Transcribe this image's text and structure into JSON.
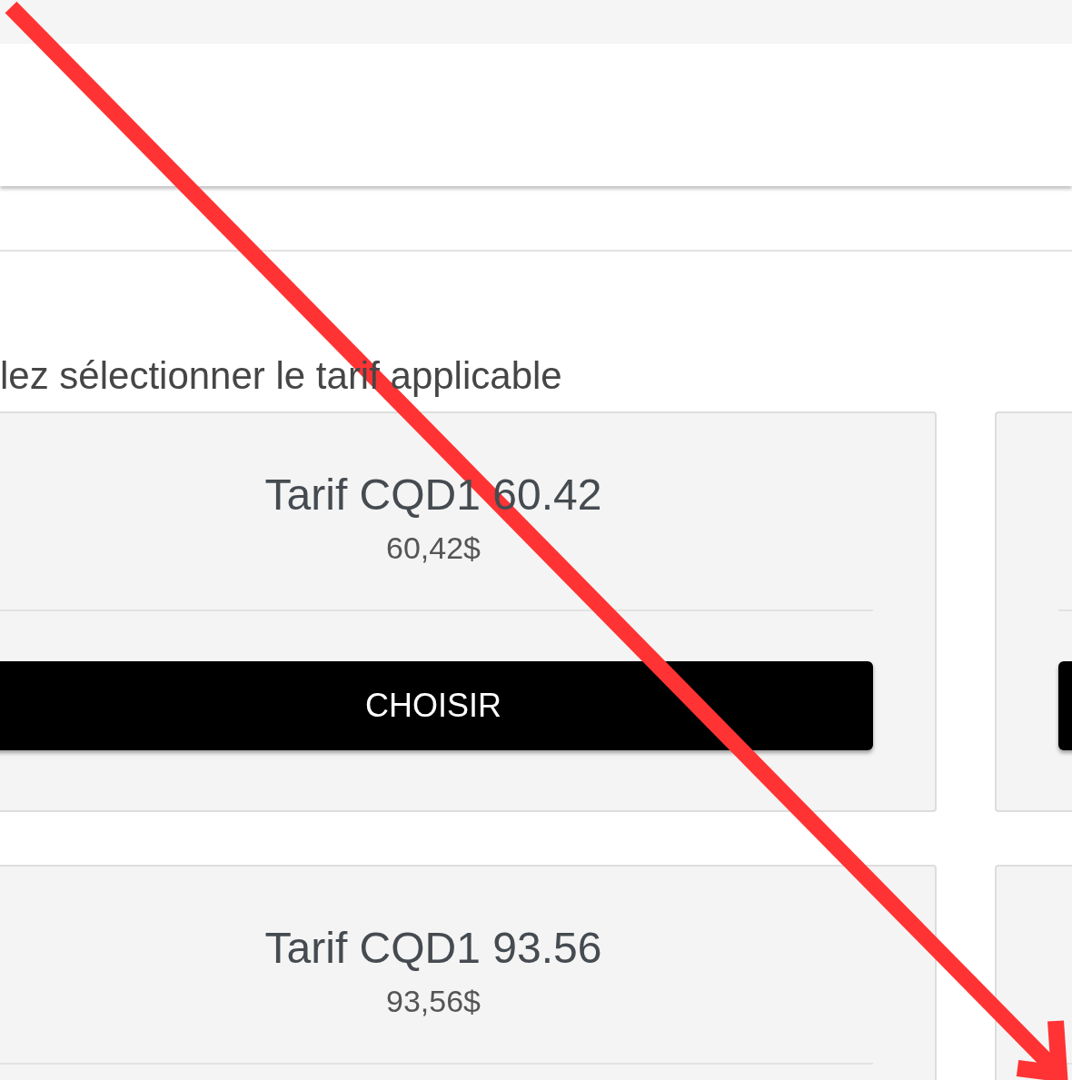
{
  "heading": "lez sélectionner le tarif applicable",
  "rows": [
    {
      "cards": [
        {
          "kind": "full",
          "title": "Tarif CQD1 60.42",
          "price": "60,42$",
          "button": "CHOISIR"
        },
        {
          "kind": "edge"
        }
      ]
    },
    {
      "cards": [
        {
          "kind": "full",
          "title": "Tarif CQD1 93.56",
          "price": "93,56$"
        },
        {
          "kind": "edge"
        }
      ]
    }
  ]
}
